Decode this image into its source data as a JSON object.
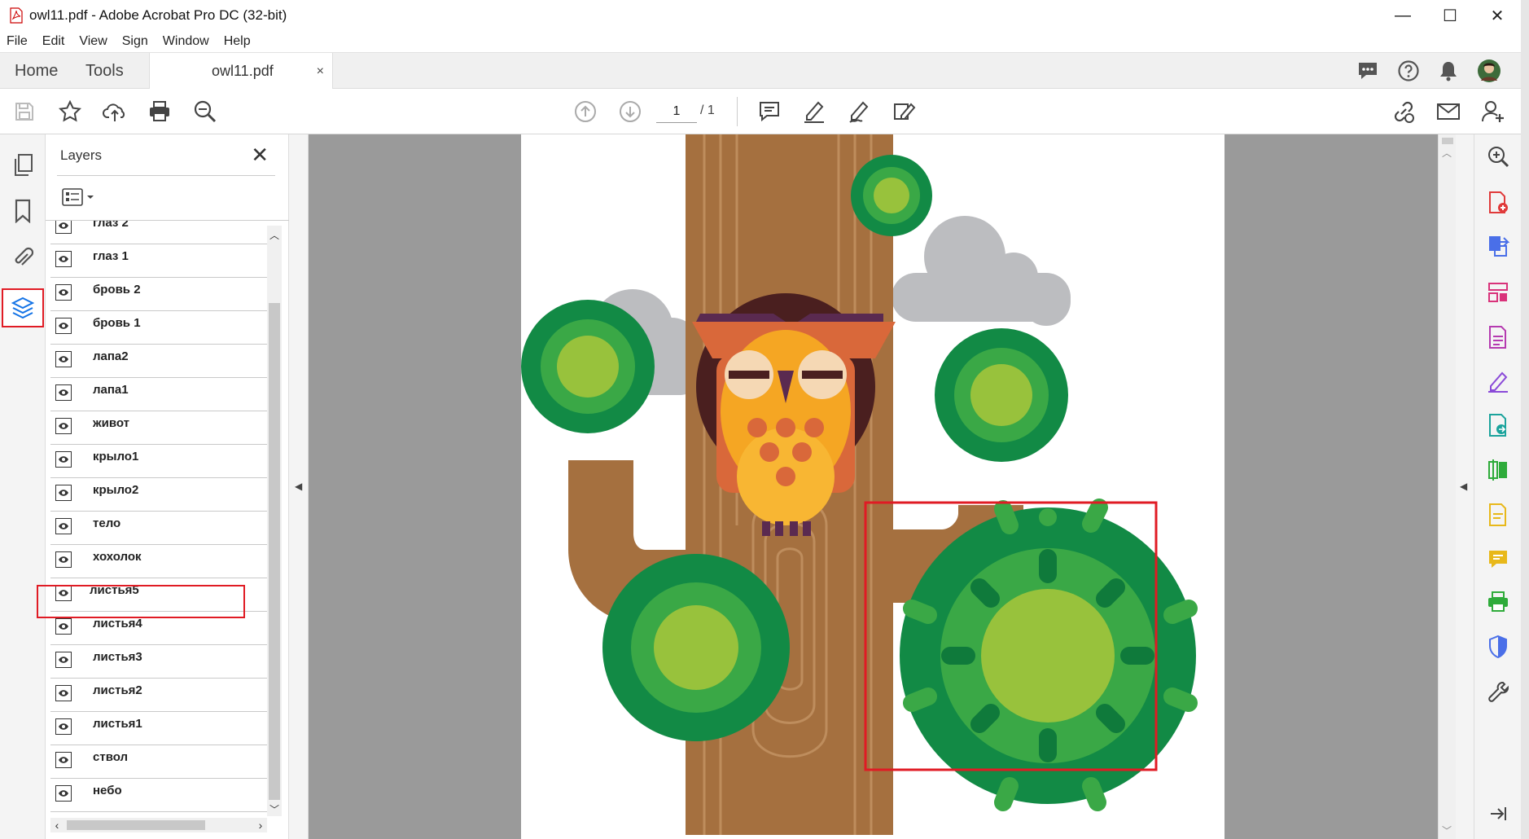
{
  "window": {
    "title": "owl11.pdf - Adobe Acrobat Pro DC (32-bit)",
    "minimize": "—",
    "maximize": "☐",
    "close": "✕"
  },
  "menu": [
    "File",
    "Edit",
    "View",
    "Sign",
    "Window",
    "Help"
  ],
  "tabs": {
    "home": "Home",
    "tools": "Tools",
    "document": "owl11.pdf",
    "document_close": "×"
  },
  "toolbar": {
    "page_current": "1",
    "page_total": "/ 1"
  },
  "layers_panel": {
    "title": "Layers",
    "close": "✕",
    "items": [
      "глаз 2",
      "глаз 1",
      "бровь 2",
      "бровь 1",
      "лапа2",
      "лапа1",
      "живот",
      "крыло1",
      "крыло2",
      "тело",
      "хохолок",
      "листья5",
      "листья4",
      "листья3",
      "листья2",
      "листья1",
      "ствол",
      "небо"
    ],
    "highlighted": "листья5"
  },
  "colors": {
    "highlight": "#e01b24",
    "tree_trunk": "#a5703f",
    "leaf_dark": "#128a45",
    "leaf_mid": "#3aa846",
    "leaf_light": "#98c23c",
    "cloud": "#bcbdc0",
    "owl_orange": "#f5a623",
    "owl_dark": "#4a1f1f"
  }
}
